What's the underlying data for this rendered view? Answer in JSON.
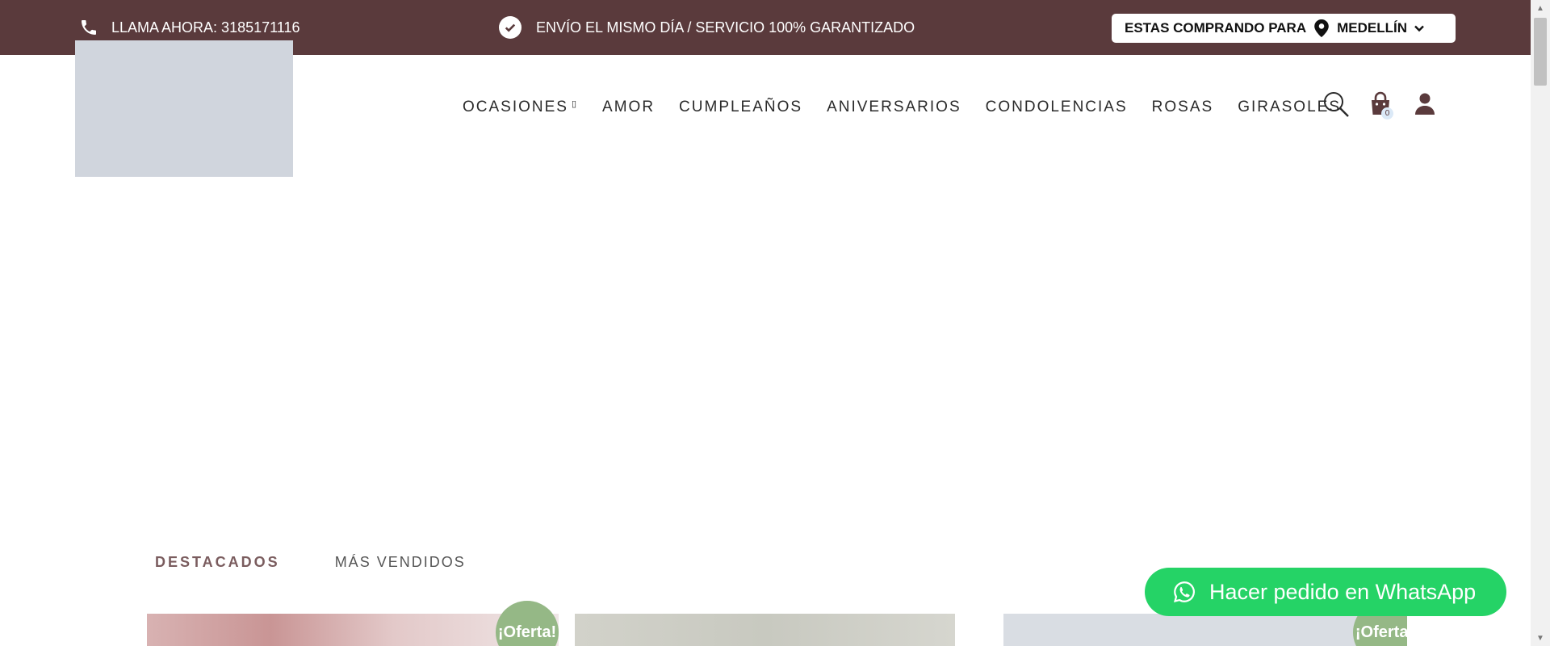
{
  "topbar": {
    "phone_text": "LLAMA AHORA: 3185171116",
    "shipping_text": "ENVÍO EL MISMO DÍA / SERVICIO 100% GARANTIZADO",
    "city_prefix": "ESTAS COMPRANDO PARA",
    "city": "MEDELLÍN",
    "bg_color": "#5a3a3c"
  },
  "nav": {
    "items": [
      {
        "label": "OCASIONES",
        "has_dropdown": true
      },
      {
        "label": "AMOR"
      },
      {
        "label": "CUMPLEAÑOS"
      },
      {
        "label": "ANIVERSARIOS"
      },
      {
        "label": "CONDOLENCIAS"
      },
      {
        "label": "ROSAS"
      },
      {
        "label": "GIRASOLES"
      }
    ],
    "dropdown_glyph": "▯"
  },
  "header_icons": {
    "search": "search-icon",
    "cart": "shopping-bag-icon",
    "cart_count": "0",
    "account": "user-icon"
  },
  "tabs": {
    "active": "DESTACADOS",
    "inactive": "MÁS VENDIDOS"
  },
  "products": {
    "badges": [
      "¡Oferta!",
      "¡Oferta!"
    ]
  },
  "whatsapp": {
    "label": "Hacer pedido en WhatsApp",
    "color": "#25d366"
  }
}
